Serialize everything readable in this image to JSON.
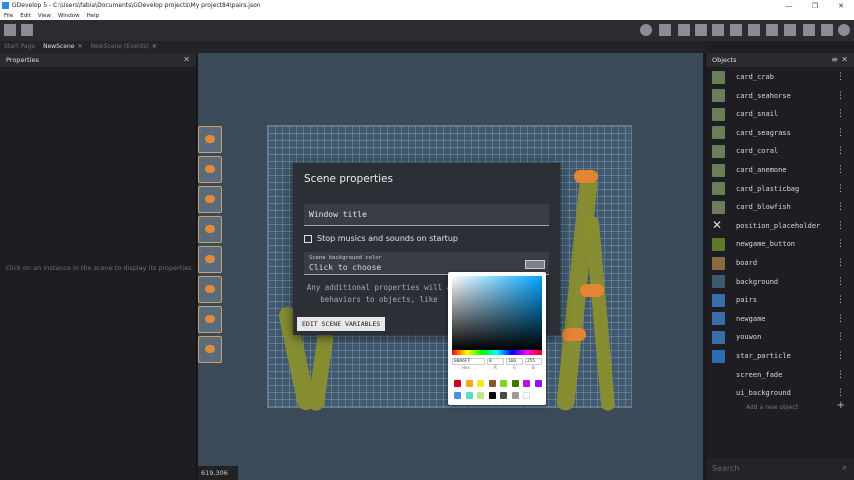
{
  "titlebar": {
    "title": "GDevelop 5 - C:\\Users\\fabia\\Documents\\GDevelop projects\\My project84\\pairs.json",
    "minimize": "—",
    "maximize": "❐",
    "close": "✕"
  },
  "menu": {
    "items": [
      "File",
      "Edit",
      "View",
      "Window",
      "Help"
    ]
  },
  "tabs": [
    {
      "label": "Start Page",
      "active": false
    },
    {
      "label": "NewScene",
      "active": true,
      "close": "✕"
    },
    {
      "label": "NewScene (Events)",
      "active": false,
      "close": "✕"
    }
  ],
  "properties": {
    "title": "Properties",
    "close": "✕",
    "hint": "Click on an instance in the scene to display its properties"
  },
  "canvas": {
    "coords": "619,306"
  },
  "dialog": {
    "title": "Scene properties",
    "window_title_placeholder": "Window title",
    "stop_music_label": "Stop musics and sounds on startup",
    "bg_color_label": "Scene background color",
    "bg_color_value": "Click to choose",
    "note": "Any additional properties will a behaviors to objects, like",
    "edit_vars": "EDIT SCENE VARIABLES"
  },
  "color_picker": {
    "hex": "00A6FF",
    "r": "0",
    "g": "166",
    "b": "255",
    "hex_label": "Hex",
    "r_label": "R",
    "g_label": "G",
    "b_label": "B",
    "presets": [
      "#d0021b",
      "#f5a623",
      "#f8e71c",
      "#8b572a",
      "#7ed321",
      "#417505",
      "#bd10e0",
      "#9013fe",
      "#4a90e2",
      "#50e3c2",
      "#b8e986",
      "#000000",
      "#4a4a4a",
      "#9b9b9b",
      "#ffffff"
    ]
  },
  "objects": {
    "title": "Objects",
    "menu_icon": "≡",
    "close": "✕",
    "items": [
      {
        "name": "card_crab",
        "icon": "card-icon"
      },
      {
        "name": "card_seahorse",
        "icon": "card-icon"
      },
      {
        "name": "card_snail",
        "icon": "card-icon"
      },
      {
        "name": "card_seagrass",
        "icon": "card-icon"
      },
      {
        "name": "card_coral",
        "icon": "card-icon"
      },
      {
        "name": "card_anemone",
        "icon": "card-icon"
      },
      {
        "name": "card_plasticbag",
        "icon": "card-icon"
      },
      {
        "name": "card_blowfish",
        "icon": "card-icon"
      },
      {
        "name": "position_placeholder",
        "icon": "cross-icon"
      },
      {
        "name": "newgame_button",
        "icon": "button-icon"
      },
      {
        "name": "board",
        "icon": "board-icon"
      },
      {
        "name": "background",
        "icon": "background-icon"
      },
      {
        "name": "pairs",
        "icon": "text-icon"
      },
      {
        "name": "newgame",
        "icon": "text-icon"
      },
      {
        "name": "youwon",
        "icon": "text-icon"
      },
      {
        "name": "star_particle",
        "icon": "particle-icon"
      },
      {
        "name": "screen_fade",
        "icon": "shape-icon"
      },
      {
        "name": "ui_background",
        "icon": "shape-icon"
      }
    ],
    "add_new": "Add a new object",
    "add_plus": "+",
    "search_placeholder": "Search",
    "search_icon": "⌕",
    "more_glyph": "⋮"
  }
}
